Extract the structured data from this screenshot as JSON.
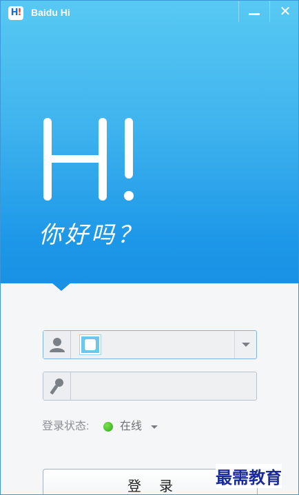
{
  "window": {
    "title": "Baidu Hi",
    "logo_text": "Hi!",
    "minimize_label": "—",
    "close_label": "✕"
  },
  "hero": {
    "headline": "Hi!",
    "greeting": "你好吗？"
  },
  "login": {
    "username_value": "",
    "password_value": "",
    "status_label": "登录状态:",
    "status_value": "在线",
    "status_color": "#3cc21f",
    "login_button": "登录"
  },
  "watermark": "最需教育",
  "colors": {
    "accent_top": "#58c9f3",
    "accent_bottom": "#1a91e4"
  }
}
